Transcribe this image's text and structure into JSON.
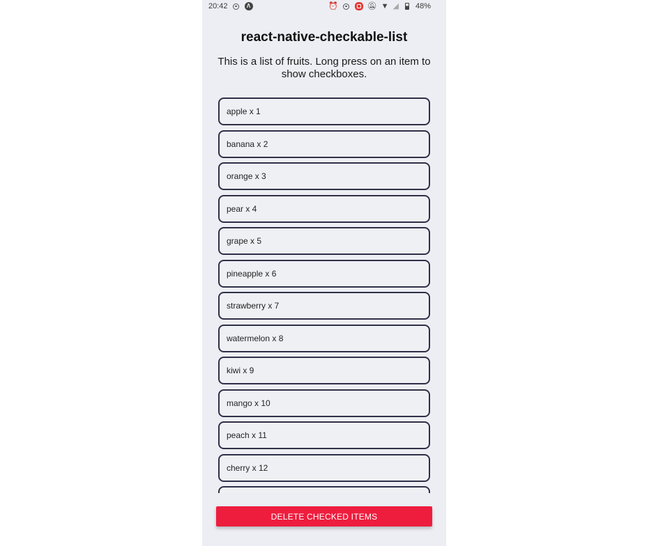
{
  "status_bar": {
    "time": "20:42",
    "left_icons": [
      "screen-record-icon",
      "app-icon"
    ],
    "right_icons": [
      "alarm-icon",
      "sync-icon",
      "recording-icon",
      "mute-icon",
      "wifi-icon",
      "signal-icon",
      "battery-icon"
    ],
    "battery": "48%"
  },
  "header": {
    "title": "react-native-checkable-list",
    "subtitle": "This is a list of fruits. Long press on an item to show checkboxes."
  },
  "list": {
    "items": [
      {
        "label": "apple x 1"
      },
      {
        "label": "banana x 2"
      },
      {
        "label": "orange x 3"
      },
      {
        "label": "pear x 4"
      },
      {
        "label": "grape x 5"
      },
      {
        "label": "pineapple x 6"
      },
      {
        "label": "strawberry x 7"
      },
      {
        "label": "watermelon x 8"
      },
      {
        "label": "kiwi x 9"
      },
      {
        "label": "mango x 10"
      },
      {
        "label": "peach x 11"
      },
      {
        "label": "cherry x 12"
      },
      {
        "label": ""
      }
    ]
  },
  "actions": {
    "delete_label": "DELETE CHECKED ITEMS",
    "delete_color": "#ee1d3e"
  }
}
